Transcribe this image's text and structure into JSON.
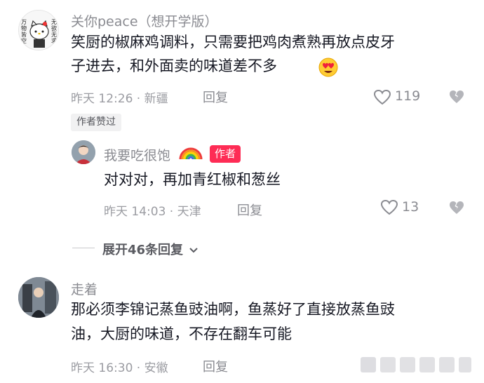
{
  "comments": [
    {
      "author": "关你peace（想开学版）",
      "avatar_text": [
        "万物皆空",
        "无欲无求"
      ],
      "text_line1": "笑厨的椒麻鸡调料，只需要把鸡肉煮熟再放点皮牙",
      "text_line2": "子进去，和外面卖的味道差不多",
      "meta": "昨天 12:26 · 新疆",
      "reply_label": "回复",
      "likes": "119",
      "badge": "作者赞过"
    },
    {
      "author": "我要吃很饱",
      "author_badge": "作者",
      "text": "对对对，再加青红椒和葱丝",
      "meta": "昨天 14:03 · 天津",
      "reply_label": "回复",
      "likes": "13"
    },
    {
      "author": "走着",
      "text_line1": "那必须李锦记蒸鱼豉油啊，鱼蒸好了直接放蒸鱼豉",
      "text_line2": "油，大厨的味道，不存在翻车可能",
      "meta": "昨天 16:30 · 安徽",
      "reply_label": "回复"
    }
  ],
  "expand_replies": "展开46条回复",
  "icons": {
    "like": "heart-outline-icon",
    "dislike": "broken-heart-icon",
    "expand": "chevron-down-icon",
    "emoji": "heart-eyes-emoji-icon",
    "rainbow": "rainbow-emoji-icon"
  },
  "colors": {
    "author_badge": "#fe2c55",
    "meta_text": "#9b9ca2",
    "body_text": "#161823"
  }
}
